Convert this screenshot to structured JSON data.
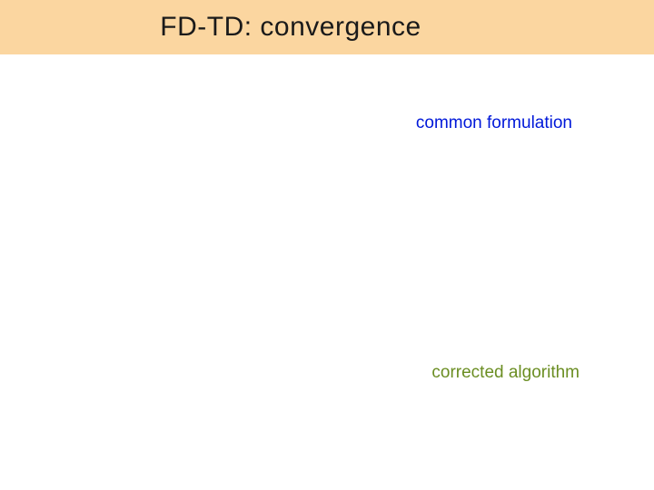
{
  "title": "FD-TD: convergence",
  "labels": {
    "common": "common formulation",
    "corrected": "corrected algorithm"
  }
}
